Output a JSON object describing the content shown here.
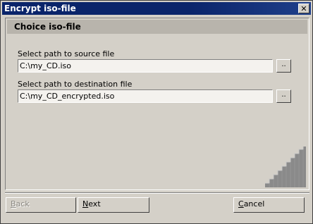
{
  "window": {
    "title": "Encrypt iso-file",
    "close_glyph": "✕"
  },
  "page": {
    "header": "Choice iso-file"
  },
  "source": {
    "label": "Select path to source file",
    "value": "C:\\my_CD.iso",
    "browse_label": ".."
  },
  "destination": {
    "label": "Select path to destination file",
    "value": "C:\\my_CD_encrypted.iso",
    "browse_label": ".."
  },
  "buttons": {
    "back": {
      "mnemonic": "B",
      "rest": "ack",
      "enabled": false
    },
    "next": {
      "mnemonic": "N",
      "rest": "ext",
      "enabled": true
    },
    "cancel": {
      "mnemonic": "C",
      "rest": "ancel",
      "enabled": true
    }
  },
  "icons": {
    "close": "close-icon",
    "decoration": "staircase-icon"
  }
}
